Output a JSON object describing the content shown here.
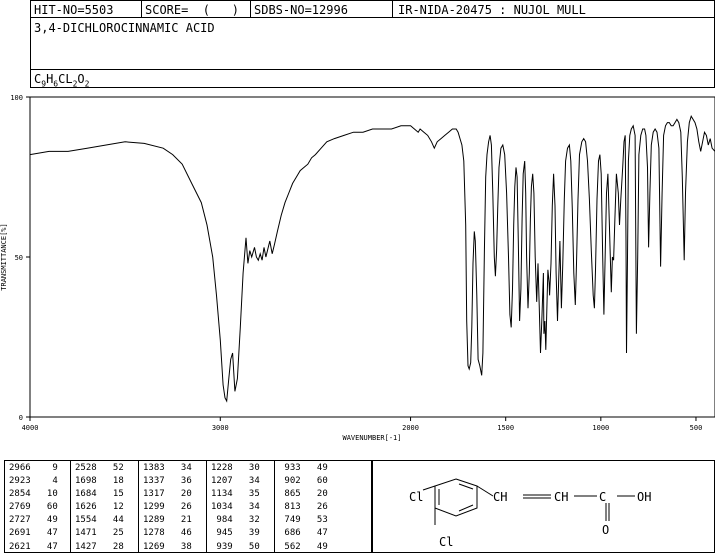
{
  "header": {
    "hit_no": "HIT-NO=5503",
    "score": "SCORE=  (   )",
    "sdbs_no": "SDBS-NO=12996",
    "ir_nida": "IR-NIDA-20475 : NUJOL MULL",
    "compound_name": "3,4-DICHLOROCINNAMIC ACID",
    "formula_parts": [
      "C",
      "9",
      "H",
      "6",
      "CL",
      "2",
      "O",
      "2"
    ]
  },
  "chart_data": {
    "type": "line",
    "xlabel": "WAVENUMBER[-1]",
    "ylabel": "TRANSMITTANCE[%]",
    "xlim": [
      4000,
      400
    ],
    "ylim": [
      0,
      100
    ],
    "x_ticks": [
      4000,
      3000,
      2000,
      1500,
      1000,
      500
    ],
    "y_ticks": [
      0,
      50,
      100
    ],
    "x_tick_labels": [
      "4000",
      "3000",
      "2000",
      "1500",
      "1000",
      "500"
    ],
    "y_tick_labels": [
      "0",
      "50",
      "100"
    ],
    "series": [
      {
        "points": [
          [
            4000,
            82
          ],
          [
            3900,
            83
          ],
          [
            3800,
            83
          ],
          [
            3700,
            84
          ],
          [
            3600,
            85
          ],
          [
            3500,
            86
          ],
          [
            3400,
            85.5
          ],
          [
            3300,
            84
          ],
          [
            3250,
            82
          ],
          [
            3200,
            79
          ],
          [
            3150,
            73
          ],
          [
            3100,
            67
          ],
          [
            3070,
            60
          ],
          [
            3040,
            50
          ],
          [
            3020,
            38
          ],
          [
            3000,
            24
          ],
          [
            2985,
            10
          ],
          [
            2975,
            6
          ],
          [
            2966,
            5
          ],
          [
            2955,
            12
          ],
          [
            2945,
            18
          ],
          [
            2935,
            20
          ],
          [
            2923,
            8
          ],
          [
            2910,
            12
          ],
          [
            2895,
            28
          ],
          [
            2880,
            45
          ],
          [
            2865,
            56
          ],
          [
            2855,
            48
          ],
          [
            2845,
            52
          ],
          [
            2835,
            50
          ],
          [
            2820,
            53
          ],
          [
            2810,
            50
          ],
          [
            2800,
            49
          ],
          [
            2790,
            51
          ],
          [
            2780,
            49
          ],
          [
            2770,
            53
          ],
          [
            2760,
            50
          ],
          [
            2740,
            55
          ],
          [
            2727,
            51
          ],
          [
            2715,
            54
          ],
          [
            2700,
            58
          ],
          [
            2680,
            63
          ],
          [
            2660,
            67
          ],
          [
            2640,
            70
          ],
          [
            2620,
            73
          ],
          [
            2600,
            75
          ],
          [
            2580,
            77
          ],
          [
            2560,
            78
          ],
          [
            2540,
            79
          ],
          [
            2520,
            81
          ],
          [
            2500,
            82
          ],
          [
            2470,
            84
          ],
          [
            2440,
            86
          ],
          [
            2400,
            87
          ],
          [
            2350,
            88
          ],
          [
            2300,
            89
          ],
          [
            2250,
            89
          ],
          [
            2200,
            90
          ],
          [
            2150,
            90
          ],
          [
            2100,
            90
          ],
          [
            2050,
            91
          ],
          [
            2000,
            91
          ],
          [
            1980,
            90
          ],
          [
            1960,
            89
          ],
          [
            1950,
            90
          ],
          [
            1930,
            89
          ],
          [
            1910,
            88
          ],
          [
            1890,
            86
          ],
          [
            1875,
            84
          ],
          [
            1860,
            86
          ],
          [
            1840,
            87
          ],
          [
            1820,
            88
          ],
          [
            1800,
            89
          ],
          [
            1780,
            90
          ],
          [
            1760,
            90
          ],
          [
            1750,
            89
          ],
          [
            1740,
            87
          ],
          [
            1730,
            85
          ],
          [
            1720,
            80
          ],
          [
            1710,
            60
          ],
          [
            1705,
            30
          ],
          [
            1698,
            16
          ],
          [
            1692,
            15
          ],
          [
            1684,
            17
          ],
          [
            1678,
            28
          ],
          [
            1672,
            48
          ],
          [
            1665,
            58
          ],
          [
            1660,
            55
          ],
          [
            1652,
            38
          ],
          [
            1645,
            18
          ],
          [
            1636,
            16
          ],
          [
            1626,
            13
          ],
          [
            1620,
            20
          ],
          [
            1612,
            52
          ],
          [
            1605,
            75
          ],
          [
            1598,
            82
          ],
          [
            1590,
            86
          ],
          [
            1582,
            88
          ],
          [
            1575,
            85
          ],
          [
            1568,
            70
          ],
          [
            1560,
            50
          ],
          [
            1554,
            44
          ],
          [
            1548,
            52
          ],
          [
            1542,
            65
          ],
          [
            1535,
            78
          ],
          [
            1525,
            84
          ],
          [
            1515,
            85
          ],
          [
            1505,
            82
          ],
          [
            1495,
            70
          ],
          [
            1485,
            50
          ],
          [
            1478,
            32
          ],
          [
            1471,
            28
          ],
          [
            1464,
            40
          ],
          [
            1458,
            60
          ],
          [
            1452,
            72
          ],
          [
            1446,
            78
          ],
          [
            1440,
            75
          ],
          [
            1434,
            55
          ],
          [
            1427,
            30
          ],
          [
            1420,
            40
          ],
          [
            1414,
            62
          ],
          [
            1408,
            76
          ],
          [
            1400,
            80
          ],
          [
            1395,
            70
          ],
          [
            1390,
            50
          ],
          [
            1383,
            34
          ],
          [
            1376,
            45
          ],
          [
            1370,
            62
          ],
          [
            1365,
            72
          ],
          [
            1358,
            76
          ],
          [
            1352,
            70
          ],
          [
            1345,
            50
          ],
          [
            1337,
            36
          ],
          [
            1330,
            48
          ],
          [
            1324,
            35
          ],
          [
            1317,
            20
          ],
          [
            1310,
            30
          ],
          [
            1302,
            45
          ],
          [
            1299,
            26
          ],
          [
            1294,
            30
          ],
          [
            1289,
            21
          ],
          [
            1282,
            38
          ],
          [
            1278,
            46
          ],
          [
            1272,
            42
          ],
          [
            1269,
            38
          ],
          [
            1262,
            48
          ],
          [
            1255,
            66
          ],
          [
            1248,
            76
          ],
          [
            1241,
            66
          ],
          [
            1235,
            45
          ],
          [
            1228,
            30
          ],
          [
            1222,
            42
          ],
          [
            1215,
            55
          ],
          [
            1207,
            34
          ],
          [
            1200,
            48
          ],
          [
            1192,
            68
          ],
          [
            1185,
            80
          ],
          [
            1175,
            84
          ],
          [
            1165,
            85
          ],
          [
            1158,
            80
          ],
          [
            1150,
            65
          ],
          [
            1142,
            45
          ],
          [
            1134,
            35
          ],
          [
            1128,
            48
          ],
          [
            1120,
            68
          ],
          [
            1112,
            82
          ],
          [
            1100,
            86
          ],
          [
            1090,
            87
          ],
          [
            1080,
            86
          ],
          [
            1070,
            80
          ],
          [
            1060,
            68
          ],
          [
            1050,
            52
          ],
          [
            1040,
            38
          ],
          [
            1034,
            34
          ],
          [
            1028,
            46
          ],
          [
            1020,
            68
          ],
          [
            1012,
            80
          ],
          [
            1005,
            82
          ],
          [
            998,
            76
          ],
          [
            990,
            50
          ],
          [
            984,
            32
          ],
          [
            978,
            48
          ],
          [
            970,
            70
          ],
          [
            963,
            76
          ],
          [
            955,
            60
          ],
          [
            945,
            39
          ],
          [
            939,
            50
          ],
          [
            933,
            49
          ],
          [
            926,
            62
          ],
          [
            918,
            76
          ],
          [
            908,
            70
          ],
          [
            902,
            60
          ],
          [
            895,
            68
          ],
          [
            885,
            78
          ],
          [
            878,
            86
          ],
          [
            872,
            88
          ],
          [
            868,
            55
          ],
          [
            865,
            20
          ],
          [
            860,
            50
          ],
          [
            855,
            80
          ],
          [
            848,
            88
          ],
          [
            840,
            90
          ],
          [
            830,
            91
          ],
          [
            820,
            88
          ],
          [
            813,
            26
          ],
          [
            806,
            50
          ],
          [
            800,
            82
          ],
          [
            790,
            88
          ],
          [
            780,
            90
          ],
          [
            770,
            90
          ],
          [
            763,
            88
          ],
          [
            755,
            78
          ],
          [
            749,
            53
          ],
          [
            742,
            70
          ],
          [
            735,
            85
          ],
          [
            725,
            89
          ],
          [
            715,
            90
          ],
          [
            705,
            89
          ],
          [
            695,
            84
          ],
          [
            686,
            47
          ],
          [
            678,
            70
          ],
          [
            670,
            88
          ],
          [
            660,
            91
          ],
          [
            650,
            92
          ],
          [
            640,
            92
          ],
          [
            630,
            91
          ],
          [
            620,
            91
          ],
          [
            610,
            92
          ],
          [
            600,
            93
          ],
          [
            590,
            92
          ],
          [
            580,
            89
          ],
          [
            572,
            75
          ],
          [
            562,
            49
          ],
          [
            555,
            70
          ],
          [
            545,
            86
          ],
          [
            535,
            92
          ],
          [
            525,
            94
          ],
          [
            515,
            93
          ],
          [
            505,
            92
          ],
          [
            495,
            90
          ],
          [
            485,
            86
          ],
          [
            475,
            83
          ],
          [
            465,
            86
          ],
          [
            455,
            89
          ],
          [
            445,
            88
          ],
          [
            435,
            85
          ],
          [
            425,
            87
          ],
          [
            415,
            84
          ],
          [
            400,
            83
          ]
        ]
      }
    ]
  },
  "peak_table": [
    [
      "2966",
      "9",
      "2528",
      "52",
      "1383",
      "34",
      "1228",
      "30",
      "933",
      "49"
    ],
    [
      "2923",
      "4",
      "1698",
      "18",
      "1337",
      "36",
      "1207",
      "34",
      "902",
      "60"
    ],
    [
      "2854",
      "10",
      "1684",
      "15",
      "1317",
      "20",
      "1134",
      "35",
      "865",
      "20"
    ],
    [
      "2769",
      "60",
      "1626",
      "12",
      "1299",
      "26",
      "1034",
      "34",
      "813",
      "26"
    ],
    [
      "2727",
      "49",
      "1554",
      "44",
      "1289",
      "21",
      "984",
      "32",
      "749",
      "53"
    ],
    [
      "2691",
      "47",
      "1471",
      "25",
      "1278",
      "46",
      "945",
      "39",
      "686",
      "47"
    ],
    [
      "2621",
      "47",
      "1427",
      "28",
      "1269",
      "38",
      "939",
      "50",
      "562",
      "49"
    ]
  ],
  "structure": {
    "cl_top": "Cl",
    "cl_bottom": "Cl",
    "oh": "OH",
    "o": "O",
    "c": "C"
  }
}
